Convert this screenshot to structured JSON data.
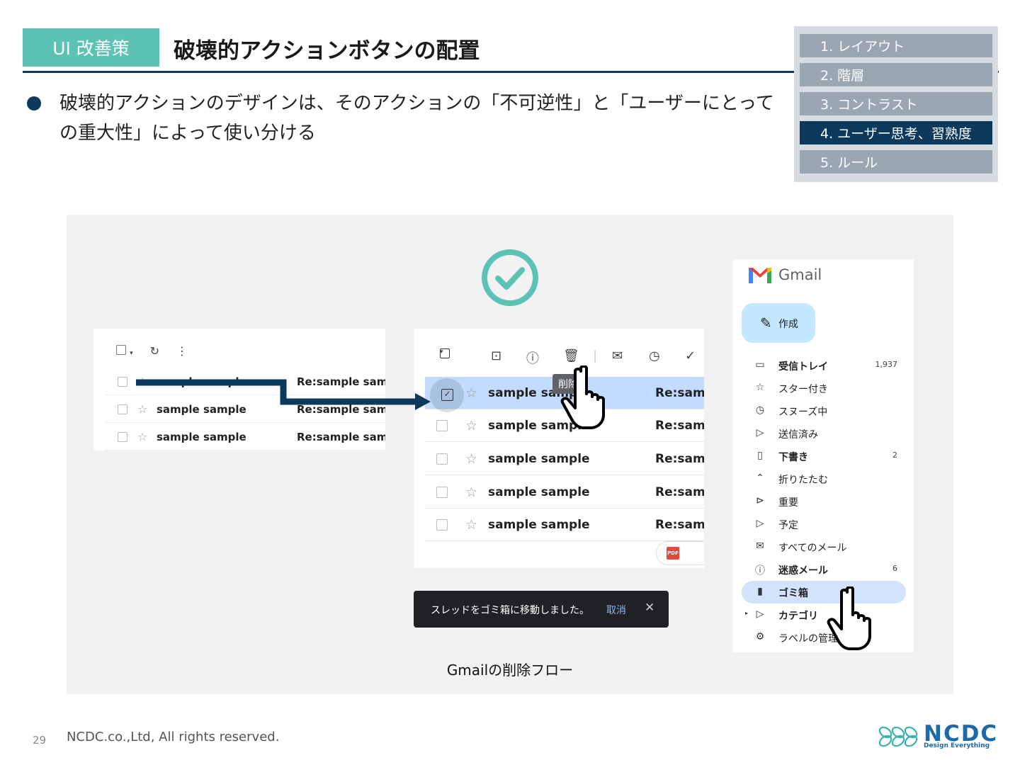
{
  "header": {
    "tag": "UI 改善策",
    "title": "破壊的アクションボタンの配置",
    "bullet": "破壊的アクションのデザインは、そのアクションの「不可逆性」と「ユーザーにとっての重大性」によって使い分ける"
  },
  "toc": [
    {
      "label": "1. レイアウト",
      "active": false
    },
    {
      "label": "2. 階層",
      "active": false
    },
    {
      "label": "3. コントラスト",
      "active": false
    },
    {
      "label": "4. ユーザー思考、習熟度",
      "active": true
    },
    {
      "label": "5. ルール",
      "active": false
    }
  ],
  "mini_list": {
    "rows": [
      {
        "sender": "sample sample",
        "subject": "Re:sample sample"
      },
      {
        "sender": "sample sample",
        "subject": "Re:sample sample"
      },
      {
        "sender": "sample sample",
        "subject": "Re:sample sample"
      }
    ]
  },
  "mid_list": {
    "tooltip": "削除",
    "rows": [
      {
        "sender": "sample sample",
        "subject": "Re:samp"
      },
      {
        "sender": "sample sample",
        "subject": "Re:samp"
      },
      {
        "sender": "sample sample",
        "subject": "Re:samp"
      },
      {
        "sender": "sample sample",
        "subject": "Re:samp"
      },
      {
        "sender": "sample sample",
        "subject": "Re:samp"
      }
    ],
    "pdf_label": "PDF"
  },
  "toast": {
    "message": "スレッドをゴミ箱に移動しました。",
    "undo": "取消",
    "close": "✕"
  },
  "caption": "Gmailの削除フロー",
  "gmail": {
    "name": "Gmail",
    "compose": "作成",
    "nav": [
      {
        "icon": "inbox-icon",
        "glyph": "▭",
        "label": "受信トレイ",
        "count": "1,937",
        "bold": true
      },
      {
        "icon": "star-icon",
        "glyph": "☆",
        "label": "スター付き",
        "count": "",
        "bold": false
      },
      {
        "icon": "clock-icon",
        "glyph": "◷",
        "label": "スヌーズ中",
        "count": "",
        "bold": false
      },
      {
        "icon": "send-icon",
        "glyph": "▷",
        "label": "送信済み",
        "count": "",
        "bold": false
      },
      {
        "icon": "file-icon",
        "glyph": "▯",
        "label": "下書き",
        "count": "2",
        "bold": true
      },
      {
        "icon": "chevron-up-icon",
        "glyph": "⌃",
        "label": "折りたたむ",
        "count": "",
        "bold": false
      },
      {
        "icon": "important-icon",
        "glyph": "⊳",
        "label": "重要",
        "count": "",
        "bold": false
      },
      {
        "icon": "scheduled-icon",
        "glyph": "▷",
        "label": "予定",
        "count": "",
        "bold": false
      },
      {
        "icon": "all-mail-icon",
        "glyph": "✉",
        "label": "すべてのメール",
        "count": "",
        "bold": false
      },
      {
        "icon": "spam-icon",
        "glyph": "ⓘ",
        "label": "迷惑メール",
        "count": "6",
        "bold": true
      },
      {
        "icon": "trash-icon",
        "glyph": "▮",
        "label": "ゴミ箱",
        "count": "",
        "bold": true
      },
      {
        "icon": "label-icon",
        "glyph": "▷",
        "label": "カテゴリ",
        "count": "",
        "bold": true
      },
      {
        "icon": "gear-icon",
        "glyph": "⚙",
        "label": "ラベルの管理",
        "count": "",
        "bold": false
      }
    ],
    "active_index": 10
  },
  "footer": {
    "page": "29",
    "copyright": "NCDC.co.,Ltd, All rights reserved.",
    "logo_word": "NCDC",
    "logo_sub": "Design Everything"
  },
  "colors": {
    "accent": "#5cc2b4",
    "navy": "#0d3a5c",
    "toc_inactive": "#9aa6b2",
    "selection": "#c2dbff",
    "active_nav": "#d3e3fd"
  }
}
